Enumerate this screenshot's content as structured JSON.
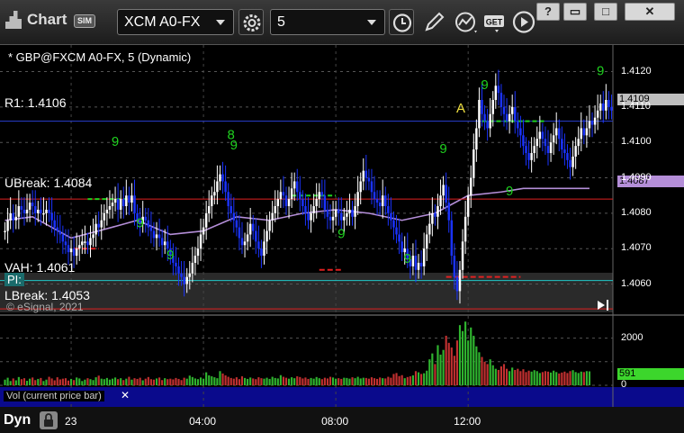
{
  "window": {
    "title": "Chart",
    "sim_badge": "SIM",
    "symbol_field": "XCM A0-FX",
    "interval_field": "5",
    "buttons": {
      "minimize": "?",
      "restore": "□",
      "close": "✕"
    }
  },
  "chart_header": "* GBP@FXCM A0-FX, 5 (Dynamic)",
  "copyright": "© eSignal, 2021",
  "levels": {
    "r1": "R1: 1.4106",
    "ubreak": "UBreak: 1.4084",
    "vah": "VAH: 1.4061",
    "lbreak": "LBreak: 1.4053",
    "pi": "PI:",
    "marker_a": "A"
  },
  "price_tags": {
    "last": "1.4109",
    "ma": "1.4087",
    "volume": "591"
  },
  "volume_panel": {
    "legend": "Vol (current price bar)",
    "close": "✕"
  },
  "bottom_bar": {
    "dyn": "Dyn",
    "lock_icon": "lock-icon"
  },
  "colors": {
    "up": "#ffffff",
    "down": "#1a33ff",
    "ma": "#b48ed8",
    "r1": "#2a3fd0",
    "ubreak": "#e02020",
    "vah": "#20c8c8",
    "lbreak": "#e02020",
    "td": "#1fd11f",
    "volume_up": "#2fb52f",
    "volume_down": "#c23030",
    "tag_green": "#3cd62c"
  },
  "chart_data": [
    {
      "type": "candlestick",
      "title": "* GBP@FXCM A0-FX, 5 (Dynamic)",
      "ylim": [
        1.4052,
        1.4127
      ],
      "y_ticks": [
        1.412,
        1.411,
        1.41,
        1.409,
        1.408,
        1.407,
        1.406
      ],
      "x_tick_labels": [
        "23",
        "04:00",
        "08:00",
        "12:00"
      ],
      "x_tick_index": [
        24,
        72,
        120,
        168
      ],
      "reference_lines": [
        {
          "label": "R1: 1.4106",
          "value": 1.4106
        },
        {
          "label": "UBreak: 1.4084",
          "value": 1.4084
        },
        {
          "label": "VAH: 1.4061",
          "value": 1.4061
        },
        {
          "label": "LBreak: 1.4053",
          "value": 1.4053
        }
      ],
      "close": [
        1.4075,
        1.4078,
        1.408,
        1.4078,
        1.4079,
        1.4082,
        1.4081,
        1.408,
        1.4081,
        1.4083,
        1.4082,
        1.408,
        1.4081,
        1.408,
        1.408,
        1.4081,
        1.408,
        1.4078,
        1.4076,
        1.4075,
        1.4074,
        1.4072,
        1.4071,
        1.4069,
        1.407,
        1.4068,
        1.407,
        1.4071,
        1.4072,
        1.4072,
        1.4071,
        1.4073,
        1.4074,
        1.4077,
        1.4076,
        1.4078,
        1.408,
        1.4081,
        1.4082,
        1.4083,
        1.4084,
        1.4081,
        1.4084,
        1.4082,
        1.4085,
        1.4083,
        1.4085,
        1.408,
        1.4078,
        1.4077,
        1.4079,
        1.4078,
        1.4076,
        1.4075,
        1.4073,
        1.4074,
        1.4073,
        1.4071,
        1.4072,
        1.407,
        1.4068,
        1.4066,
        1.4065,
        1.4063,
        1.4062,
        1.406,
        1.4062,
        1.4063,
        1.4066,
        1.4068,
        1.407,
        1.4074,
        1.4076,
        1.408,
        1.4082,
        1.4085,
        1.4086,
        1.4089,
        1.4091,
        1.4089,
        1.4086,
        1.4082,
        1.408,
        1.4078,
        1.4076,
        1.4073,
        1.4071,
        1.4072,
        1.4074,
        1.4077,
        1.4075,
        1.4072,
        1.407,
        1.4068,
        1.4072,
        1.4075,
        1.4078,
        1.408,
        1.4082,
        1.4084,
        1.4086,
        1.4085,
        1.4082,
        1.4084,
        1.4087,
        1.4089,
        1.4086,
        1.4084,
        1.4082,
        1.408,
        1.4078,
        1.408,
        1.4082,
        1.4084,
        1.4086,
        1.4085,
        1.4081,
        1.4079,
        1.4078,
        1.4079,
        1.4081,
        1.408,
        1.4078,
        1.4079,
        1.408,
        1.4081,
        1.4079,
        1.4082,
        1.4086,
        1.4089,
        1.4092,
        1.409,
        1.4089,
        1.4086,
        1.4084,
        1.4083,
        1.4082,
        1.4085,
        1.4082,
        1.408,
        1.4078,
        1.4076,
        1.4074,
        1.4072,
        1.4069,
        1.407,
        1.4067,
        1.4065,
        1.4068,
        1.4064,
        1.4066,
        1.4065,
        1.407,
        1.4074,
        1.4077,
        1.408,
        1.4079,
        1.4082,
        1.4085,
        1.4088,
        1.4083,
        1.4078,
        1.4068,
        1.4062,
        1.4058,
        1.4064,
        1.4072,
        1.4079,
        1.4085,
        1.409,
        1.4098,
        1.4104,
        1.4112,
        1.4108,
        1.4106,
        1.4104,
        1.4108,
        1.4112,
        1.4116,
        1.4114,
        1.411,
        1.4108,
        1.4106,
        1.4108,
        1.411,
        1.4106,
        1.4104,
        1.4102,
        1.4099,
        1.4097,
        1.4095,
        1.4097,
        1.4099,
        1.4101,
        1.4103,
        1.4101,
        1.4099,
        1.4097,
        1.41,
        1.4102,
        1.4104,
        1.4101,
        1.4098,
        1.4097,
        1.4095,
        1.4093,
        1.4096,
        1.4099,
        1.4101,
        1.4104,
        1.4102,
        1.4104,
        1.4106,
        1.4105,
        1.4107,
        1.4109,
        1.4111,
        1.4109,
        1.4112,
        1.411,
        1.4109
      ],
      "moving_average": [
        {
          "x": 0,
          "y": 1.4078
        },
        {
          "x": 10,
          "y": 1.4079
        },
        {
          "x": 24,
          "y": 1.4073
        },
        {
          "x": 34,
          "y": 1.4075
        },
        {
          "x": 48,
          "y": 1.4078
        },
        {
          "x": 60,
          "y": 1.4074
        },
        {
          "x": 72,
          "y": 1.4075
        },
        {
          "x": 84,
          "y": 1.4079
        },
        {
          "x": 96,
          "y": 1.4078
        },
        {
          "x": 108,
          "y": 1.408
        },
        {
          "x": 120,
          "y": 1.4081
        },
        {
          "x": 132,
          "y": 1.408
        },
        {
          "x": 144,
          "y": 1.4078
        },
        {
          "x": 156,
          "y": 1.408
        },
        {
          "x": 168,
          "y": 1.4085
        },
        {
          "x": 180,
          "y": 1.4086
        },
        {
          "x": 188,
          "y": 1.4087
        },
        {
          "x": 196,
          "y": 1.4087
        },
        {
          "x": 212,
          "y": 1.4087
        }
      ],
      "annotations": [
        {
          "x": 40,
          "y": 1.4099,
          "text": "9"
        },
        {
          "x": 49,
          "y": 1.4076,
          "text": "9"
        },
        {
          "x": 60,
          "y": 1.4067,
          "text": "9"
        },
        {
          "x": 82,
          "y": 1.4101,
          "text": "8"
        },
        {
          "x": 83,
          "y": 1.4098,
          "text": "9"
        },
        {
          "x": 122,
          "y": 1.4073,
          "text": "9"
        },
        {
          "x": 146,
          "y": 1.4066,
          "text": "9"
        },
        {
          "x": 159,
          "y": 1.4097,
          "text": "9"
        },
        {
          "x": 174,
          "y": 1.4115,
          "text": "9"
        },
        {
          "x": 183,
          "y": 1.4085,
          "text": "9"
        },
        {
          "x": 216,
          "y": 1.4119,
          "text": "9"
        }
      ]
    },
    {
      "type": "bar",
      "title": "Vol (current price bar)",
      "y_ticks": [
        0,
        1000,
        2000
      ],
      "ylim": [
        0,
        2900
      ],
      "values": [
        240,
        320,
        180,
        290,
        210,
        350,
        260,
        300,
        190,
        280,
        330,
        220,
        270,
        310,
        180,
        240,
        360,
        290,
        210,
        340,
        250,
        280,
        300,
        200,
        270,
        220,
        330,
        290,
        180,
        240,
        300,
        260,
        220,
        340,
        410,
        280,
        260,
        310,
        240,
        280,
        330,
        260,
        300,
        220,
        280,
        360,
        240,
        300,
        270,
        320,
        210,
        280,
        350,
        260,
        240,
        290,
        330,
        220,
        300,
        260,
        280,
        250,
        310,
        270,
        220,
        320,
        280,
        410,
        350,
        290,
        260,
        330,
        280,
        550,
        420,
        380,
        340,
        300,
        600,
        500,
        420,
        360,
        310,
        280,
        340,
        260,
        380,
        310,
        270,
        330,
        290,
        260,
        340,
        300,
        280,
        320,
        270,
        360,
        310,
        290,
        430,
        360,
        320,
        280,
        340,
        300,
        380,
        350,
        290,
        330,
        270,
        310,
        280,
        350,
        300,
        260,
        320,
        290,
        360,
        330,
        280,
        300,
        270,
        320,
        310,
        280,
        340,
        300,
        360,
        290,
        320,
        310,
        280,
        340,
        300,
        270,
        330,
        300,
        290,
        360,
        320,
        480,
        520,
        390,
        430,
        300,
        350,
        380,
        420,
        600,
        550,
        480,
        510,
        620,
        1100,
        1350,
        900,
        1700,
        1300,
        1500,
        2100,
        1800,
        1600,
        1250,
        1900,
        2550,
        2300,
        2700,
        1900,
        2450,
        2100,
        1650,
        1400,
        1200,
        1000,
        900,
        1100,
        850,
        700,
        650,
        800,
        900,
        700,
        600,
        750,
        650,
        700,
        600,
        680,
        560,
        620,
        580,
        640,
        600,
        520,
        560,
        600,
        580,
        540,
        620,
        560,
        500,
        540,
        580,
        520,
        600,
        640,
        560,
        520,
        580,
        560,
        600,
        591
      ],
      "last_value": 591
    }
  ]
}
